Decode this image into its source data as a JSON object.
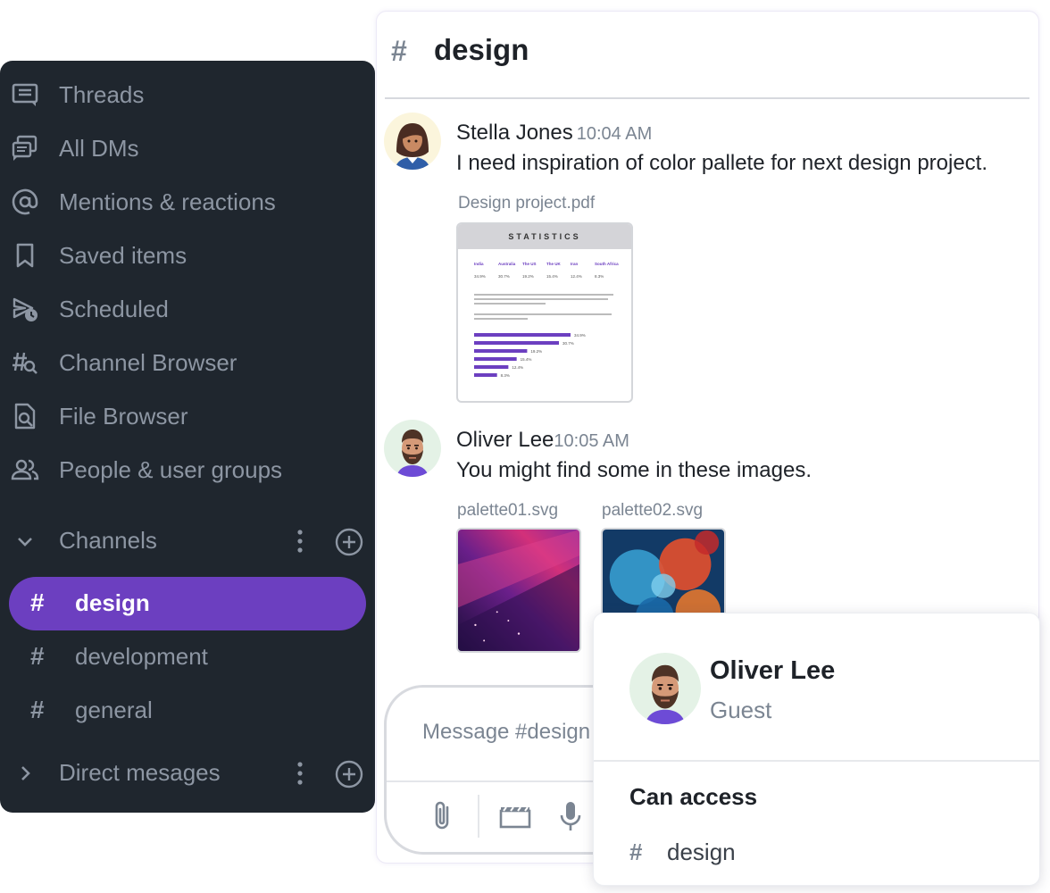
{
  "sidebar": {
    "nav": [
      {
        "label": "Threads",
        "icon": "threads-icon"
      },
      {
        "label": "All DMs",
        "icon": "dms-icon"
      },
      {
        "label": "Mentions & reactions",
        "icon": "at-icon"
      },
      {
        "label": "Saved items",
        "icon": "bookmark-icon"
      },
      {
        "label": "Scheduled",
        "icon": "scheduled-send-icon"
      },
      {
        "label": "Channel Browser",
        "icon": "channel-search-icon"
      },
      {
        "label": "File Browser",
        "icon": "file-search-icon"
      },
      {
        "label": "People & user groups",
        "icon": "people-icon"
      }
    ],
    "channels_title": "Channels",
    "channels": [
      {
        "name": "design",
        "active": true
      },
      {
        "name": "development",
        "active": false
      },
      {
        "name": "general",
        "active": false
      }
    ],
    "dm_title": "Direct mesages",
    "colors": {
      "background": "#1f262e",
      "active": "#6c3fc0",
      "text": "#8d96a3"
    }
  },
  "chat": {
    "channel_name": "design",
    "messages": [
      {
        "sender": "Stella Jones",
        "time": "10:04 AM",
        "text": "I need inspiration of color pallete for next design project.",
        "attachment": {
          "file_name": "Design project.pdf",
          "preview": {
            "heading": "STATISTICS",
            "columns": [
              "India",
              "Australia",
              "The US",
              "The UK",
              "Iran",
              "South Africa"
            ],
            "values": [
              "34.9%",
              "30.7%",
              "19.2%",
              "15.4%",
              "12.4%",
              "8.3%"
            ],
            "bars": [
              34.9,
              30.7,
              19.2,
              15.4,
              12.4,
              8.3
            ]
          }
        }
      },
      {
        "sender": "Oliver Lee",
        "time": "10:05 AM",
        "text": "You might find some in these images.",
        "attachments": [
          "palette01.svg",
          "palette02.svg"
        ]
      }
    ],
    "composer": {
      "placeholder": "Message #design"
    }
  },
  "profile_popup": {
    "name": "Oliver Lee",
    "role": "Guest",
    "access_title": "Can access",
    "access_channel": "design"
  }
}
